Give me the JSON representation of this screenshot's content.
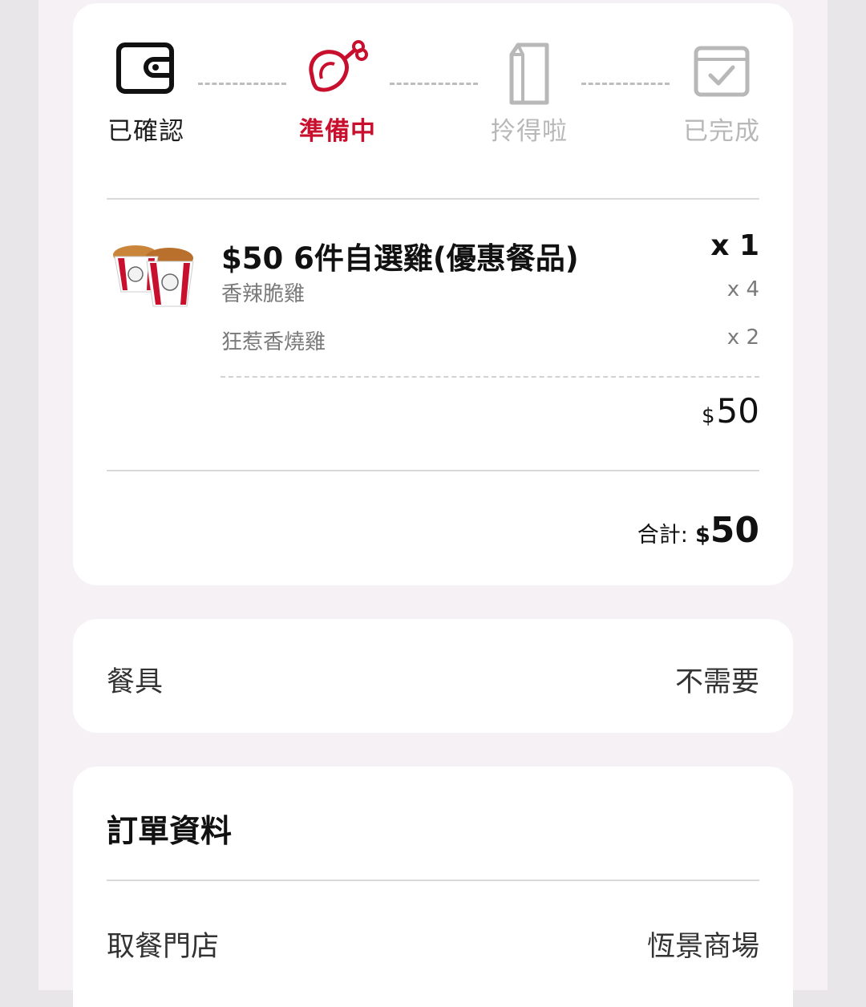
{
  "progress": {
    "steps": [
      {
        "label": "已確認",
        "status": "done",
        "icon": "wallet-icon"
      },
      {
        "label": "準備中",
        "status": "active",
        "icon": "drumstick-icon"
      },
      {
        "label": "拎得啦",
        "status": "pending",
        "icon": "paper-bag-icon"
      },
      {
        "label": "已完成",
        "status": "pending",
        "icon": "check-box-icon"
      }
    ],
    "active_color": "#c8102e"
  },
  "order_item": {
    "name": "$50 6件自選雞(優惠餐品)",
    "quantity": "x 1",
    "options": [
      {
        "name": "香辣脆雞",
        "quantity": "x 4"
      },
      {
        "name": "狂惹香燒雞",
        "quantity": "x 2"
      }
    ],
    "price_currency": "$",
    "price": "50"
  },
  "total": {
    "label": "合計:",
    "currency": "$",
    "amount": "50"
  },
  "cutlery": {
    "label": "餐具",
    "value": "不需要"
  },
  "order_info": {
    "title": "訂單資料",
    "pickup_store_label": "取餐門店",
    "pickup_store_value": "恆景商場"
  }
}
